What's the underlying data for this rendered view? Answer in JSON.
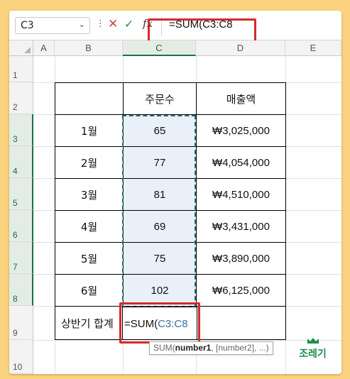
{
  "formula_bar": {
    "name_box": "C3",
    "formula": "=SUM(C3:C8",
    "fx_label": "fx"
  },
  "columns": [
    "A",
    "B",
    "C",
    "D",
    "E"
  ],
  "rows": [
    "1",
    "2",
    "3",
    "4",
    "5",
    "6",
    "7",
    "8",
    "9",
    "10"
  ],
  "table": {
    "header": {
      "label_col": "",
      "orders": "주문수",
      "sales": "매출액"
    },
    "data": [
      {
        "month": "1월",
        "orders": "65",
        "sales": "₩3,025,000"
      },
      {
        "month": "2월",
        "orders": "77",
        "sales": "₩4,054,000"
      },
      {
        "month": "3월",
        "orders": "81",
        "sales": "₩4,510,000"
      },
      {
        "month": "4월",
        "orders": "69",
        "sales": "₩3,431,000"
      },
      {
        "month": "5월",
        "orders": "75",
        "sales": "₩3,890,000"
      },
      {
        "month": "6월",
        "orders": "102",
        "sales": "₩6,125,000"
      }
    ],
    "total_label": "상반기 합계",
    "edit_prefix": "=SUM(",
    "edit_ref": "C3:C8"
  },
  "tooltip": {
    "fn": "SUM(",
    "arg1": "number1",
    "rest": ", [number2], ...)"
  },
  "logo": {
    "text": "조레기"
  },
  "colors": {
    "highlight_red": "#d42a2a",
    "excel_green": "#1e7145",
    "ref_blue": "#3a6ea5",
    "page_bg": "#fbd37f"
  }
}
